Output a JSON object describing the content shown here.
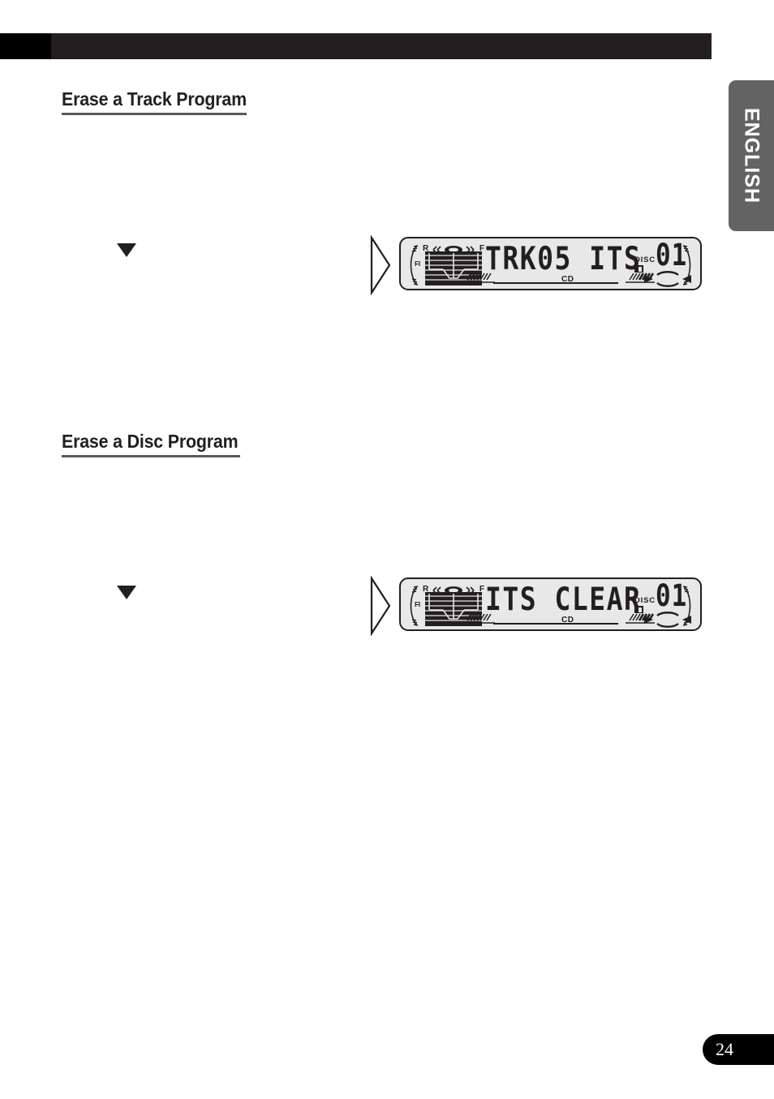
{
  "page": {
    "number": "24",
    "language_tab": "ENGLISH",
    "background_color": "#ffffff",
    "header": {
      "left_block_color": "#000000",
      "bar_color": "#231f20"
    },
    "accent_colors": {
      "heading": "#231f20",
      "rule": "#5a5a5a",
      "tab": "#636363",
      "lcd_background": "#e8e8e8",
      "lcd_outline": "#231f20"
    }
  },
  "sections": [
    {
      "title": "Erase a Track Program",
      "marker": "down-triangle",
      "chevron": "right-triangle-outline",
      "display": {
        "main_text": "TRK05 ITS",
        "media_label": "CD",
        "disc_label": "DISC",
        "disc_number": "01",
        "fader_label": "FI",
        "balance_rear": "R",
        "balance_front": "F",
        "icons": [
          "sound-stage-icon",
          "speaker-left-icon",
          "speaker-right-icon",
          "disc-icon",
          "nav-oval-icon",
          "nav-left-arrow-icon",
          "nav-right-arrow-icon",
          "level-bars-left-icon",
          "level-bars-right-icon",
          "arc-scale-left-icon",
          "arc-scale-right-icon"
        ]
      }
    },
    {
      "title": "Erase a Disc Program",
      "marker": "down-triangle",
      "chevron": "right-triangle-outline",
      "display": {
        "main_text": "ITS CLEAR",
        "media_label": "CD",
        "disc_label": "DISC",
        "disc_number": "01",
        "fader_label": "FI",
        "balance_rear": "R",
        "balance_front": "F",
        "icons": [
          "sound-stage-icon",
          "speaker-left-icon",
          "speaker-right-icon",
          "disc-icon",
          "nav-oval-icon",
          "nav-left-arrow-icon",
          "nav-right-arrow-icon",
          "level-bars-left-icon",
          "level-bars-right-icon",
          "arc-scale-left-icon",
          "arc-scale-right-icon"
        ]
      }
    }
  ]
}
